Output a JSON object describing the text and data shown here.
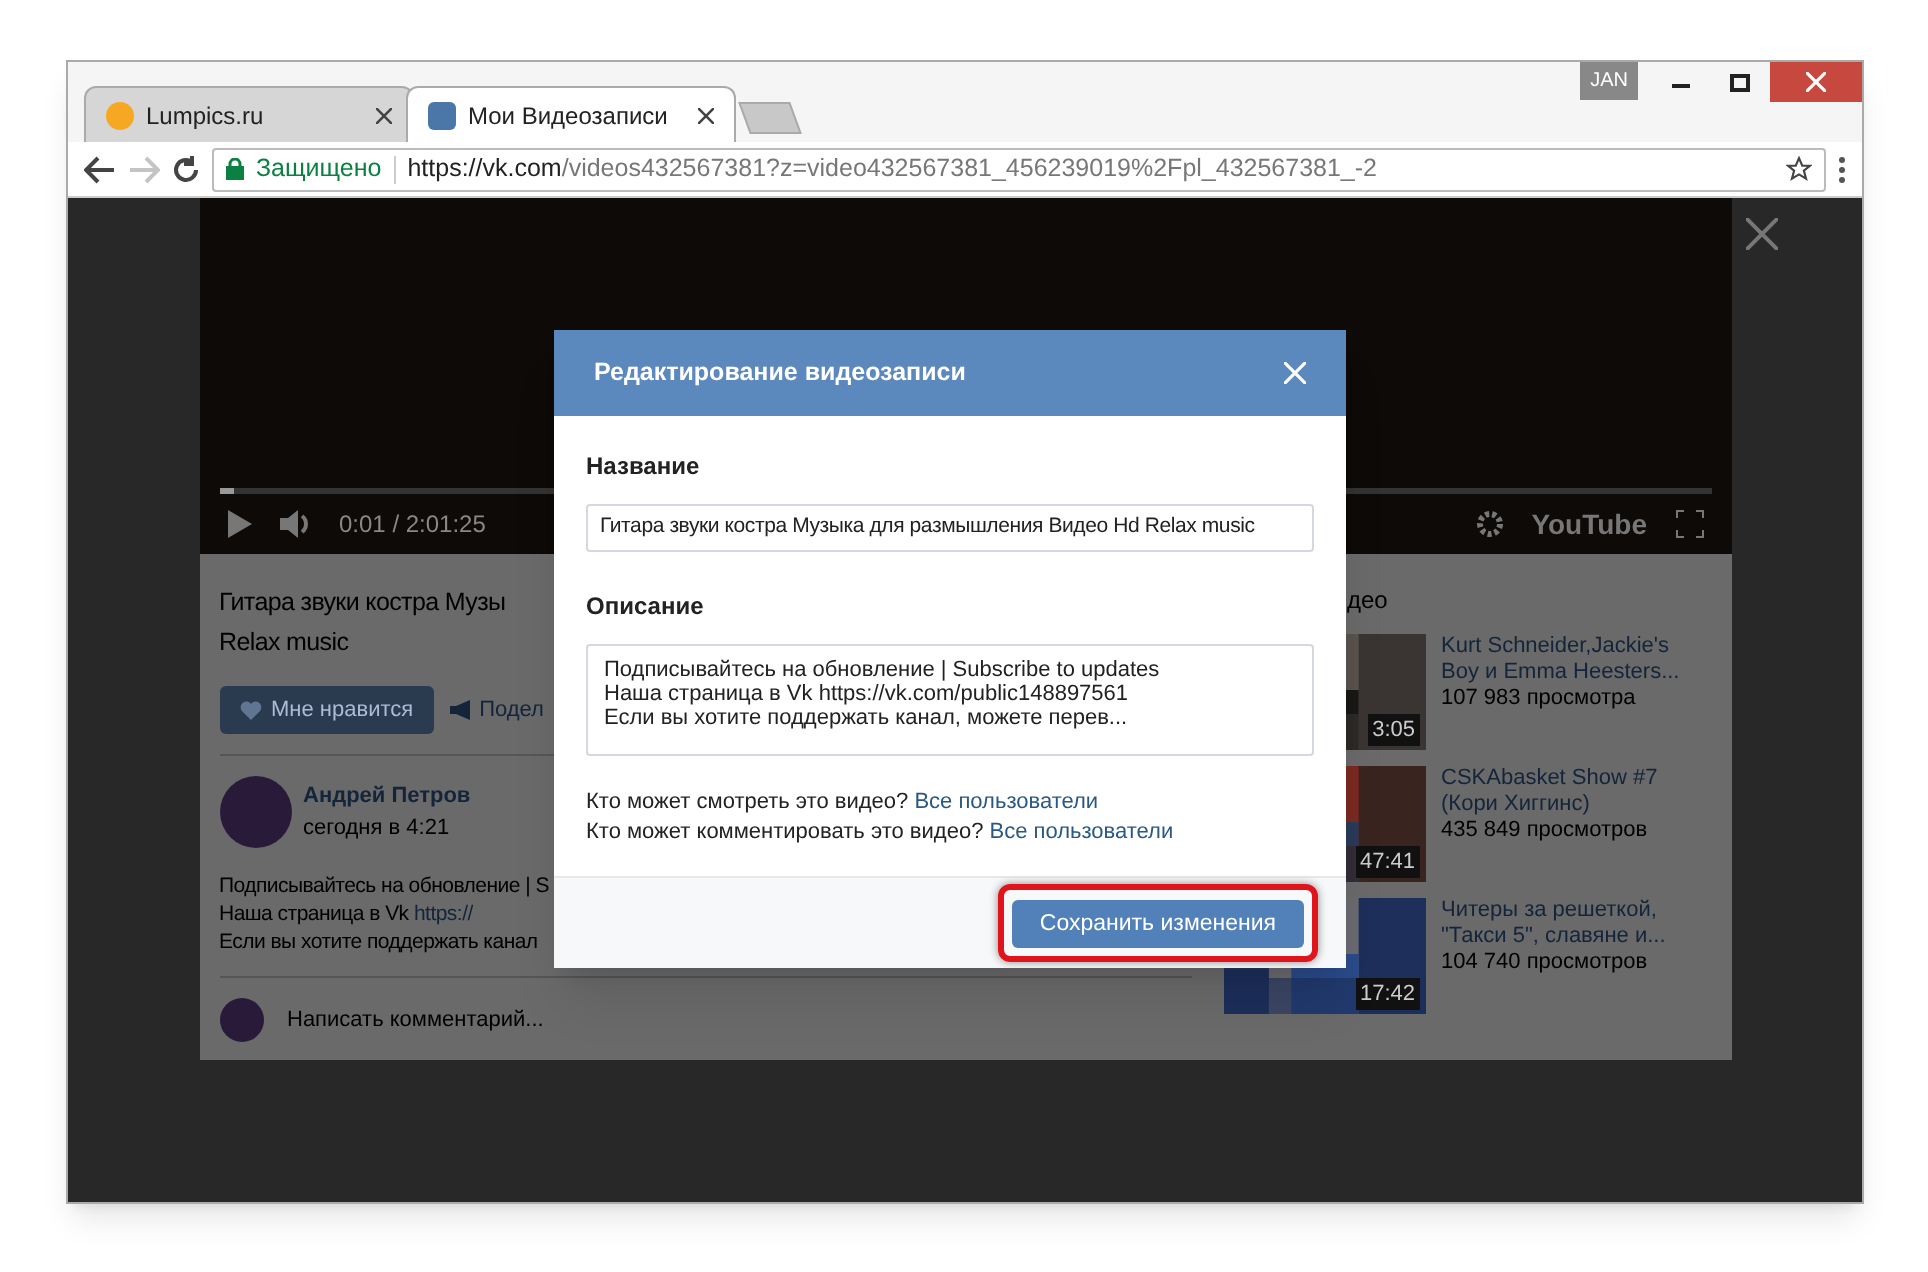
{
  "window": {
    "user_badge": "JAN"
  },
  "tabs": [
    {
      "label": "Lumpics.ru",
      "kind": "circle",
      "selected": false
    },
    {
      "label": "Мои Видеозаписи",
      "kind": "vk",
      "selected": true
    }
  ],
  "address_bar": {
    "security": "Защищено",
    "url_host": "https://vk.com",
    "url_path": "/videos432567381?z=video432567381_456239019%2Fpl_432567381_-2",
    "forward_disabled": true
  },
  "player": {
    "time": "0:01 / 2:01:25",
    "logo": "YouTube",
    "level": 0.01
  },
  "video": {
    "title_lines": [
      "Гитара звуки костра Музы",
      "Relax music"
    ],
    "like": "Мне нравится",
    "share": "Подел"
  },
  "post": {
    "author": "Андрей Петров",
    "meta": "сегодня в 4:21",
    "lines": [
      {
        "text": "Подписывайтесь на обновление | S"
      },
      {
        "text": "Наша страница в Vk ",
        "link": "https://"
      },
      {
        "text": "Если вы хотите поддержать канал"
      }
    ],
    "comment_placeholder": "Написать комментарий..."
  },
  "related": {
    "heading": "део",
    "videos": [
      {
        "title": "Kurt Schneider,Jackie's Boy и Emma Heesters...",
        "views": "107 983 просмотра",
        "duration": "3:05"
      },
      {
        "title": "CSKAbasket Show #7 (Кори Хиггинс)",
        "views": "435 849 просмотров",
        "duration": "47:41"
      },
      {
        "title": "Читеры за решеткой, \"Такси 5\", славяне и...",
        "views": "104 740 просмотров",
        "duration": "17:42"
      }
    ]
  },
  "dialog": {
    "title": "Редактирование видеозаписи",
    "name_label": "Название",
    "name_value": "Гитара звуки костра Музыка для размышления Видео Hd Relax music",
    "description_label": "Описание",
    "description_value": "Подписывайтесь на обновление | Subscribe to updates\nНаша страница в Vk https://vk.com/public148897561\nЕсли вы хотите поддержать канал, можете перев...",
    "privacy": [
      {
        "question": "Кто может смотреть это видео? ",
        "value": "Все пользователи"
      },
      {
        "question": "Кто может комментировать это видео? ",
        "value": "Все пользователи"
      }
    ],
    "save_button": "Сохранить изменения",
    "save_highlighted": true
  }
}
